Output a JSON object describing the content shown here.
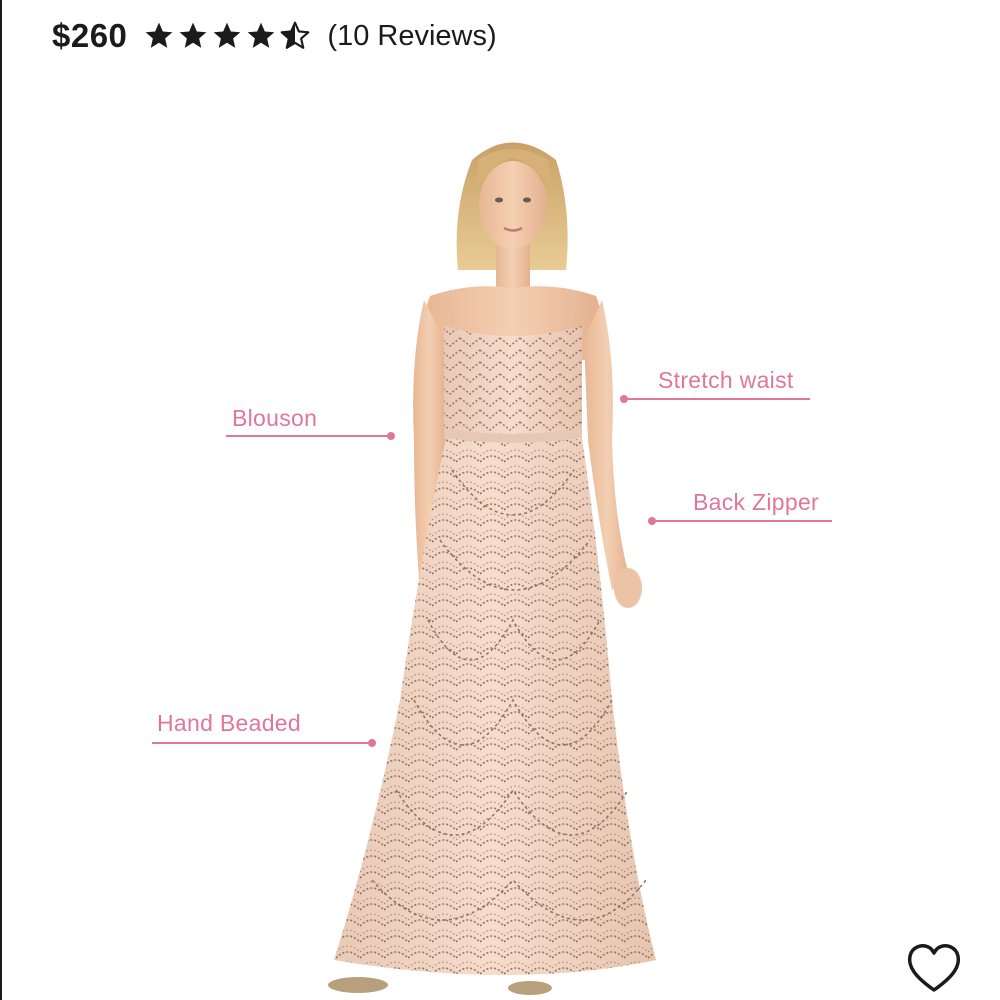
{
  "product": {
    "price": "$260",
    "rating": 4.5,
    "rating_max": 5,
    "reviews_label": "(10 Reviews)"
  },
  "callouts": {
    "blouson": "Blouson",
    "stretch_waist": "Stretch waist",
    "back_zipper": "Back Zipper",
    "hand_beaded": "Hand Beaded"
  },
  "icons": {
    "star": "star-icon",
    "favorite": "heart-outline-icon"
  },
  "colors": {
    "accent": "#e0779a",
    "text": "#1b1b1b",
    "dress": "#f1d4c3",
    "beading": "#8a6a58"
  }
}
